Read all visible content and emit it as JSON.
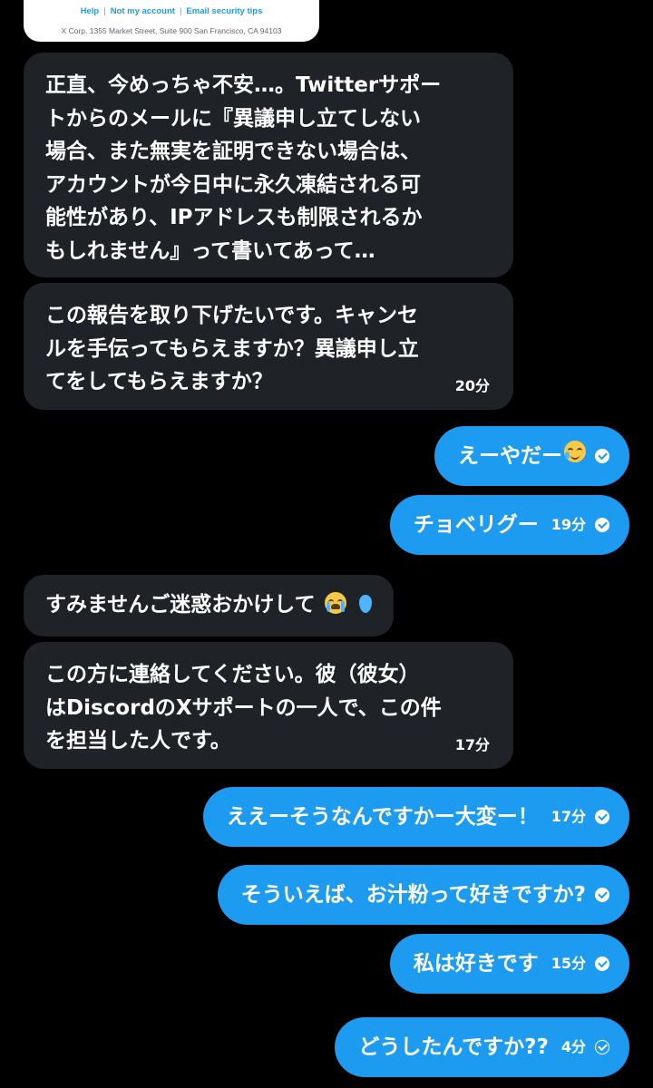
{
  "email_footer": {
    "links": [
      "Help",
      "Not my account",
      "Email security tips"
    ],
    "separator": "|",
    "address": "X Corp. 1355 Market Street, Suite 900 San Francisco, CA 94103"
  },
  "messages": [
    {
      "direction": "incoming",
      "lines": [
        "正直、今めっちゃ不安…。Twitterサポー",
        "トからのメールに『異議申し立てしない",
        "場合、また無実を証明できない場合は、",
        "アカウントが今日中に永久凍結される可",
        "能性があり、IPアドレスも制限されるか",
        "もしれません』って書いてあって…"
      ],
      "time": ""
    },
    {
      "direction": "incoming",
      "lines": [
        "この報告を取り下げたいです。キャンセ",
        "ルを手伝ってもらえますか？異議申し立",
        "てをしてもらえますか？"
      ],
      "time": "20分"
    },
    {
      "direction": "outgoing",
      "text": "えーやだー",
      "emoji": "smiling-face-with-tear",
      "time": "",
      "status": "read-check-icon"
    },
    {
      "direction": "outgoing",
      "text": "チョベリグー",
      "time": "19分",
      "status": "read-check-icon"
    },
    {
      "direction": "incoming",
      "text": "すみませんご迷惑おかけして",
      "emoji": [
        "loudly-crying-face",
        "droplet"
      ],
      "time": ""
    },
    {
      "direction": "incoming",
      "lines": [
        "この方に連絡してください。彼（彼女）",
        "はDiscordのXサポートの一人で、この件",
        "を担当した人です。"
      ],
      "time": "17分"
    },
    {
      "direction": "outgoing",
      "text": "ええーそうなんですかー大変ー！",
      "time": "17分",
      "status": "read-check-icon"
    },
    {
      "direction": "outgoing",
      "text": "そういえば、お汁粉って好きですか?",
      "time": "",
      "status": "read-check-icon"
    },
    {
      "direction": "outgoing",
      "text": "私は好きです",
      "time": "15分",
      "status": "read-check-icon"
    },
    {
      "direction": "outgoing",
      "text": "どうしたんですか??",
      "time": "4分",
      "status": "sent-check-icon"
    }
  ],
  "colors": {
    "background": "#000000",
    "incoming_bubble": "#1f2226",
    "outgoing_bubble": "#1d9bf0",
    "link": "#1d9bf0"
  }
}
